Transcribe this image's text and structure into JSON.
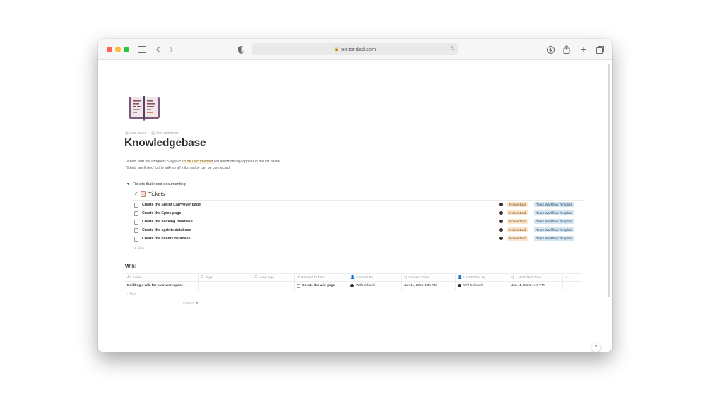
{
  "browser": {
    "url": "notiondad.com",
    "traffic_lights": {
      "close": "#ff5f57",
      "minimize": "#febc2e",
      "zoom": "#28c840"
    }
  },
  "page": {
    "title": "Knowledgebase",
    "actions": {
      "add_cover": "Add cover",
      "add_comment": "Add comment"
    },
    "description": {
      "line1_before": "Tickets with the Progress Stage of ",
      "line1_highlight": "To Be Documented",
      "line1_after": " will automatically appear in the list below.",
      "line2": "Tickets are linked to the wiki so all information can be connected."
    },
    "toggle_label": "Tickets that need documenting",
    "linked_db_name": "Tickets",
    "tickets": [
      {
        "name": "Create the Sprint Carryover page",
        "tag1": "Notion Dad",
        "tag2": "Team Workflow Template"
      },
      {
        "name": "Create the Epics page",
        "tag1": "Notion Dad",
        "tag2": "Team Workflow Template"
      },
      {
        "name": "Create the backlog database",
        "tag1": "Notion Dad",
        "tag2": "Team Workflow Template"
      },
      {
        "name": "Create the sprints database",
        "tag1": "Notion Dad",
        "tag2": "Team Workflow Template"
      },
      {
        "name": "Create the tickets database",
        "tag1": "Notion Dad",
        "tag2": "Team Workflow Template"
      }
    ],
    "new_label": "New",
    "wiki": {
      "title": "Wiki",
      "columns": [
        "Name",
        "Tags",
        "Language",
        "Related Tickets",
        "Created By",
        "Created Time",
        "Last Edited By",
        "Last Edited Time"
      ],
      "add_column": "+",
      "rows": [
        {
          "name": "Building a wiki for your workspace",
          "tags": "",
          "language": "",
          "related": "Create the wiki page",
          "created_by": "Will Helliwell",
          "created_time": "Jun 11, 2021 4:35 PM",
          "last_edited_by": "Will Helliwell",
          "last_edited_time": "Jun 11, 2021 4:40 PM"
        }
      ],
      "new_label": "New",
      "count_label": "COUNT",
      "count_value": "1"
    },
    "help": "?"
  }
}
